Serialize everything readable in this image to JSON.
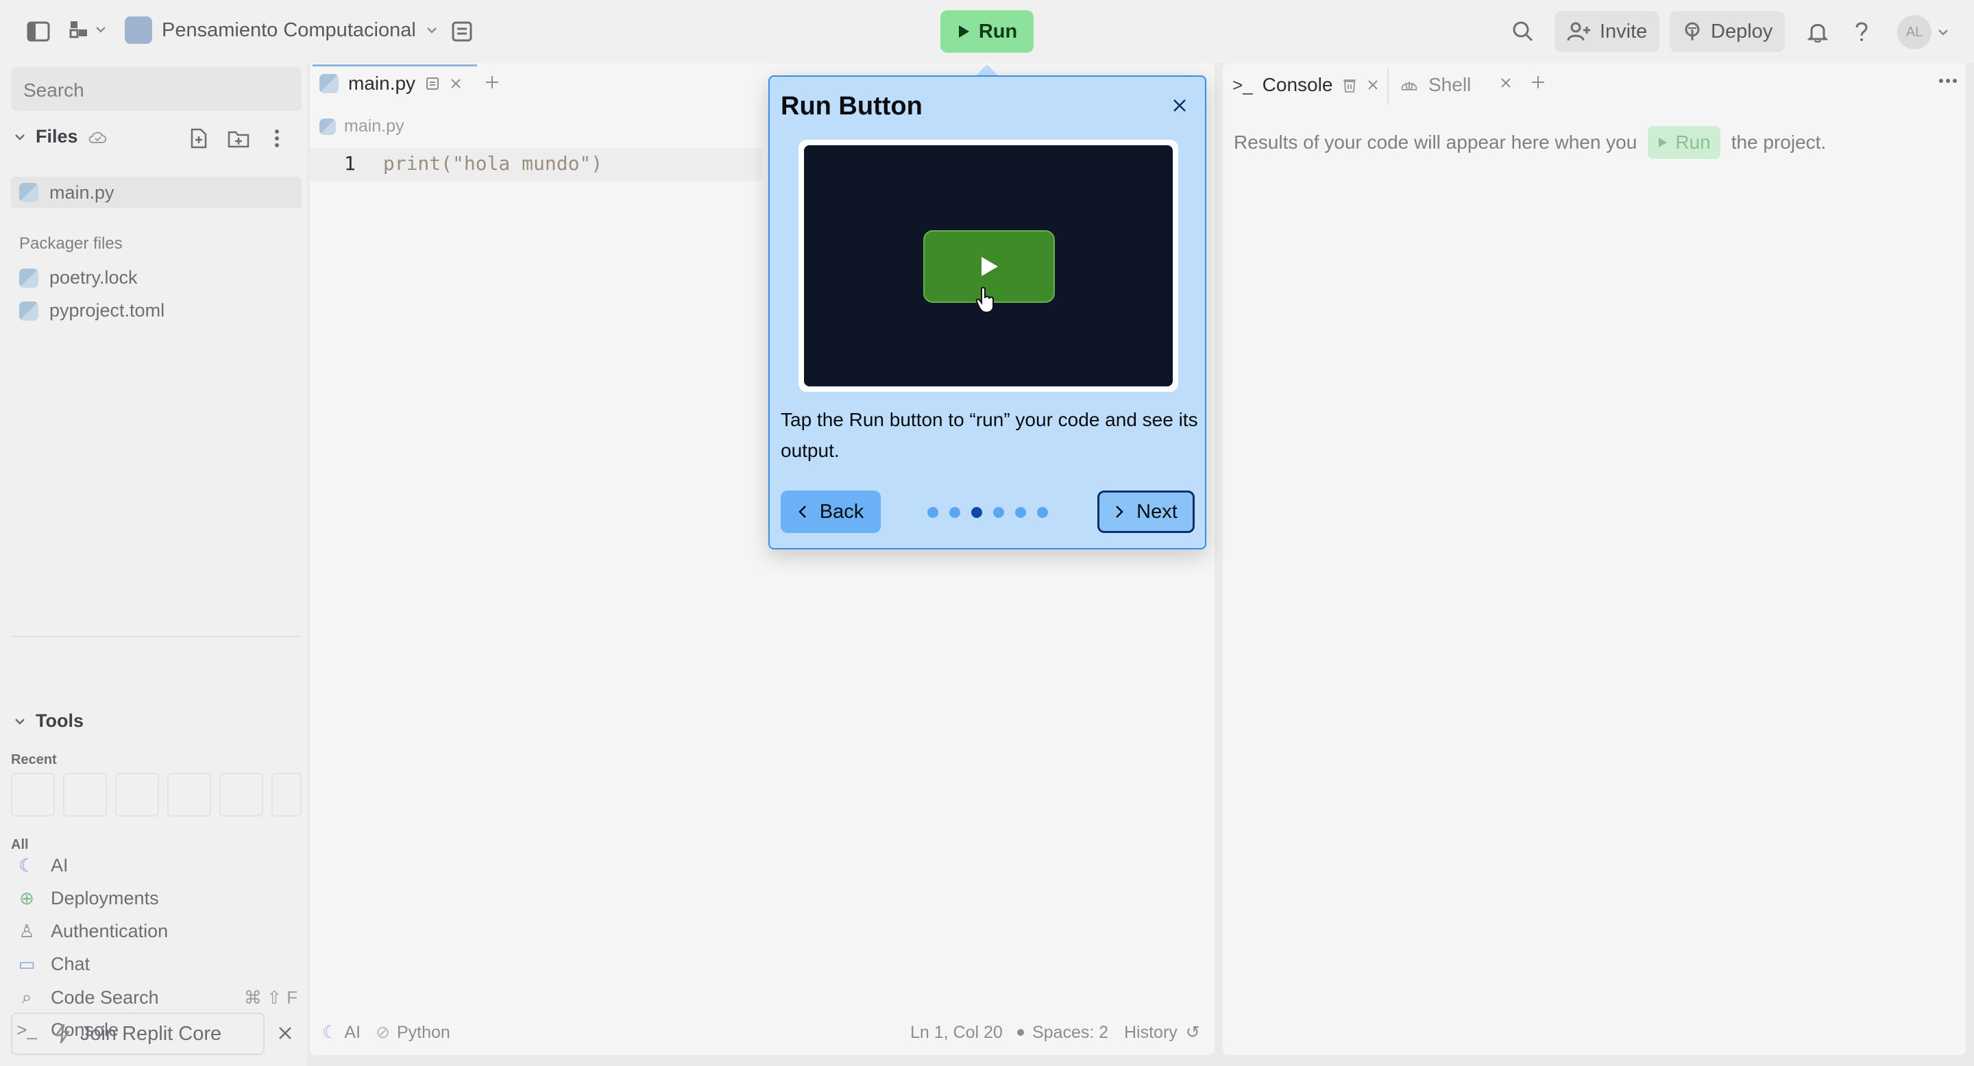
{
  "topbar": {
    "project_name": "Pensamiento Computacional",
    "run_label": "Run",
    "invite_label": "Invite",
    "deploy_label": "Deploy",
    "avatar_initials": "AL"
  },
  "sidebar": {
    "search_placeholder": "Search",
    "files_label": "Files",
    "files": [
      "main.py"
    ],
    "packager_label": "Packager files",
    "packager_files": [
      "poetry.lock",
      "pyproject.toml"
    ],
    "tools_label": "Tools",
    "recent_label": "Recent",
    "all_label": "All",
    "tools": [
      {
        "label": "AI",
        "icon": "ai-icon"
      },
      {
        "label": "Deployments",
        "icon": "deploy-icon"
      },
      {
        "label": "Authentication",
        "icon": "user-icon"
      },
      {
        "label": "Chat",
        "icon": "chat-icon"
      },
      {
        "label": "Code Search",
        "icon": "search-icon",
        "shortcut": "⌘ ⇧ F"
      },
      {
        "label": "Console",
        "icon": "terminal-icon"
      }
    ],
    "join_label": "Join Replit Core"
  },
  "editor": {
    "tab_label": "main.py",
    "breadcrumb": "main.py",
    "line_number": "1",
    "code": "print(\"hola mundo\")",
    "status": {
      "ai": "AI",
      "language": "Python",
      "position": "Ln 1, Col 20",
      "spaces": "Spaces: 2",
      "history": "History"
    }
  },
  "console": {
    "tab_console": "Console",
    "tab_shell": "Shell",
    "msg_before": "Results of your code will appear here when you",
    "msg_run": "Run",
    "msg_after": "the project."
  },
  "popover": {
    "title": "Run Button",
    "text": "Tap the Run button to “run” your code and see its output.",
    "back_label": "Back",
    "next_label": "Next",
    "step_count": 6,
    "active_step": 3
  },
  "colors": {
    "run_green": "#8ce29a",
    "popover_bg": "#bdddfb",
    "popover_border": "#3b8ede",
    "active_dot": "#0c4aa6"
  }
}
